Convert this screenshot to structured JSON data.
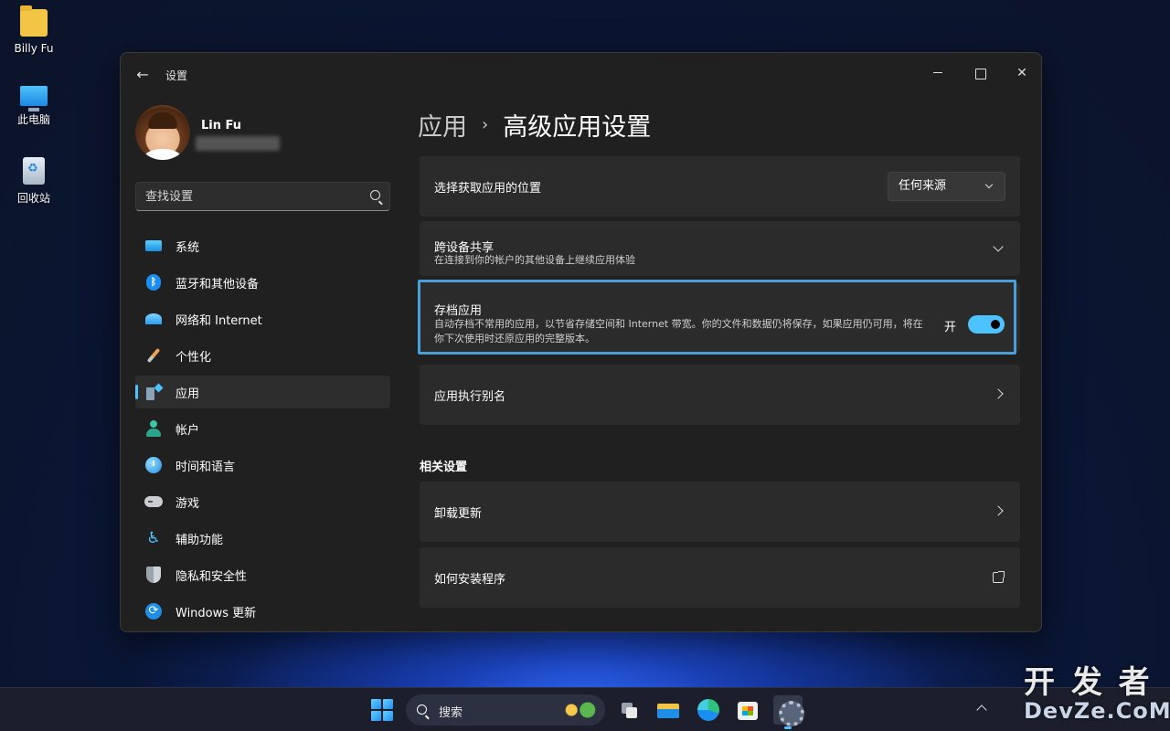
{
  "desktop": {
    "icons": [
      {
        "label": "Billy Fu",
        "icon": "folder-icon"
      },
      {
        "label": "此电脑",
        "icon": "computer-icon"
      },
      {
        "label": "回收站",
        "icon": "recycle-bin-icon"
      }
    ]
  },
  "window": {
    "title": "设置",
    "controls": {
      "minimize": "minimize-icon",
      "maximize": "maximize-icon",
      "close": "✕"
    }
  },
  "profile": {
    "name": "Lin Fu"
  },
  "search": {
    "placeholder": "查找设置"
  },
  "nav": {
    "items": [
      {
        "label": "系统",
        "icon": "system-icon",
        "active": false
      },
      {
        "label": "蓝牙和其他设备",
        "icon": "bluetooth-icon",
        "active": false
      },
      {
        "label": "网络和 Internet",
        "icon": "wifi-icon",
        "active": false
      },
      {
        "label": "个性化",
        "icon": "brush-icon",
        "active": false
      },
      {
        "label": "应用",
        "icon": "apps-icon",
        "active": true
      },
      {
        "label": "帐户",
        "icon": "account-icon",
        "active": false
      },
      {
        "label": "时间和语言",
        "icon": "clock-globe-icon",
        "active": false
      },
      {
        "label": "游戏",
        "icon": "gamepad-icon",
        "active": false
      },
      {
        "label": "辅助功能",
        "icon": "accessibility-icon",
        "active": false
      },
      {
        "label": "隐私和安全性",
        "icon": "shield-icon",
        "active": false
      },
      {
        "label": "Windows 更新",
        "icon": "update-icon",
        "active": false
      }
    ],
    "accent_color": "#4cc2ff"
  },
  "content": {
    "breadcrumb": {
      "parent": "应用",
      "separator": "›",
      "current": "高级应用设置"
    },
    "cards": {
      "app_source": {
        "title": "选择获取应用的位置",
        "dropdown_value": "任何来源"
      },
      "cross_device": {
        "title": "跨设备共享",
        "desc": "在连接到你的帐户的其他设备上继续应用体验"
      },
      "archive": {
        "title": "存档应用",
        "desc": "自动存档不常用的应用，以节省存储空间和 Internet 带宽。你的文件和数据仍将保存，如果应用仍可用，将在你下次使用时还原应用的完整版本。",
        "toggle_label": "开",
        "toggle_on": true
      },
      "alias": {
        "title": "应用执行别名"
      }
    },
    "related_title": "相关设置",
    "related": {
      "uninstall": {
        "title": "卸载更新"
      },
      "install": {
        "title": "如何安装程序"
      }
    }
  },
  "taskbar": {
    "search_label": "搜索",
    "apps": [
      "task-view-icon",
      "file-explorer-icon",
      "edge-icon",
      "store-icon",
      "settings-icon"
    ]
  },
  "watermark": {
    "line1": "开 发 者",
    "line2": "DevZe.CoM"
  }
}
